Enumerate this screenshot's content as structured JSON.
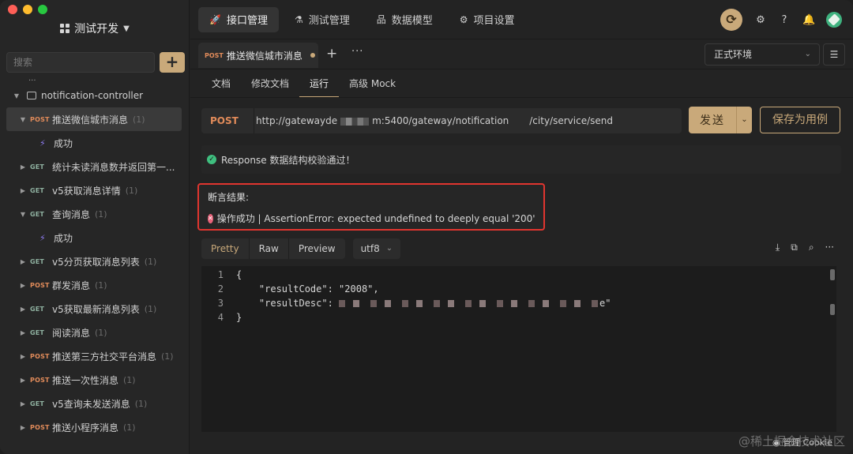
{
  "project": {
    "name": "测试开发"
  },
  "search": {
    "placeholder": "搜索"
  },
  "tree": {
    "truncated_top": "...",
    "folder": "notification-controller",
    "items": [
      {
        "method": "POST",
        "label": "推送微信城市消息",
        "count": "(1)",
        "active": true
      },
      {
        "sub": true,
        "label": "成功"
      },
      {
        "method": "GET",
        "label": "统计未读消息数并返回第一...",
        "count": ""
      },
      {
        "method": "GET",
        "label": "v5获取消息详情",
        "count": "(1)"
      },
      {
        "method": "GET",
        "label": "查询消息",
        "count": "(1)",
        "expanded": true
      },
      {
        "sub": true,
        "label": "成功"
      },
      {
        "method": "GET",
        "label": "v5分页获取消息列表",
        "count": "(1)"
      },
      {
        "method": "POST",
        "label": "群发消息",
        "count": "(1)"
      },
      {
        "method": "GET",
        "label": "v5获取最新消息列表",
        "count": "(1)"
      },
      {
        "method": "GET",
        "label": "阅读消息",
        "count": "(1)"
      },
      {
        "method": "POST",
        "label": "推送第三方社交平台消息",
        "count": "(1)"
      },
      {
        "method": "POST",
        "label": "推送一次性消息",
        "count": "(1)"
      },
      {
        "method": "GET",
        "label": "v5查询未发送消息",
        "count": "(1)"
      },
      {
        "method": "POST",
        "label": "推送小程序消息",
        "count": "(1)"
      }
    ]
  },
  "topnav": {
    "tabs": [
      "接口管理",
      "测试管理",
      "数据模型",
      "项目设置"
    ]
  },
  "doc_tab": {
    "method": "POST",
    "label": "推送微信城市消息"
  },
  "env": {
    "selected": "正式环境"
  },
  "sub_tabs": [
    "文档",
    "修改文档",
    "运行",
    "高级 Mock"
  ],
  "request": {
    "method": "POST",
    "url_part1": "http://gatewayde",
    "url_part2": "m:5400/gateway/notification",
    "url_part3": "/city/service/send",
    "send_label": "发送",
    "save_label": "保存为用例"
  },
  "response_check": {
    "text": "Response 数据结构校验通过！"
  },
  "assertion": {
    "title": "断言结果:",
    "message": "操作成功 | AssertionError: expected undefined to deeply equal '200'"
  },
  "view_tabs": [
    "Pretty",
    "Raw",
    "Preview"
  ],
  "encoding": "utf8",
  "code": {
    "lines": [
      {
        "n": "1",
        "text": "{"
      },
      {
        "n": "2",
        "text": "    \"resultCode\": \"2008\","
      },
      {
        "n": "3",
        "text": "    \"resultDesc\": ",
        "tail": "e\""
      },
      {
        "n": "4",
        "text": "}"
      }
    ]
  },
  "watermark": "@稀土掘金技术社区",
  "cookie_label": "管理 Cookie"
}
